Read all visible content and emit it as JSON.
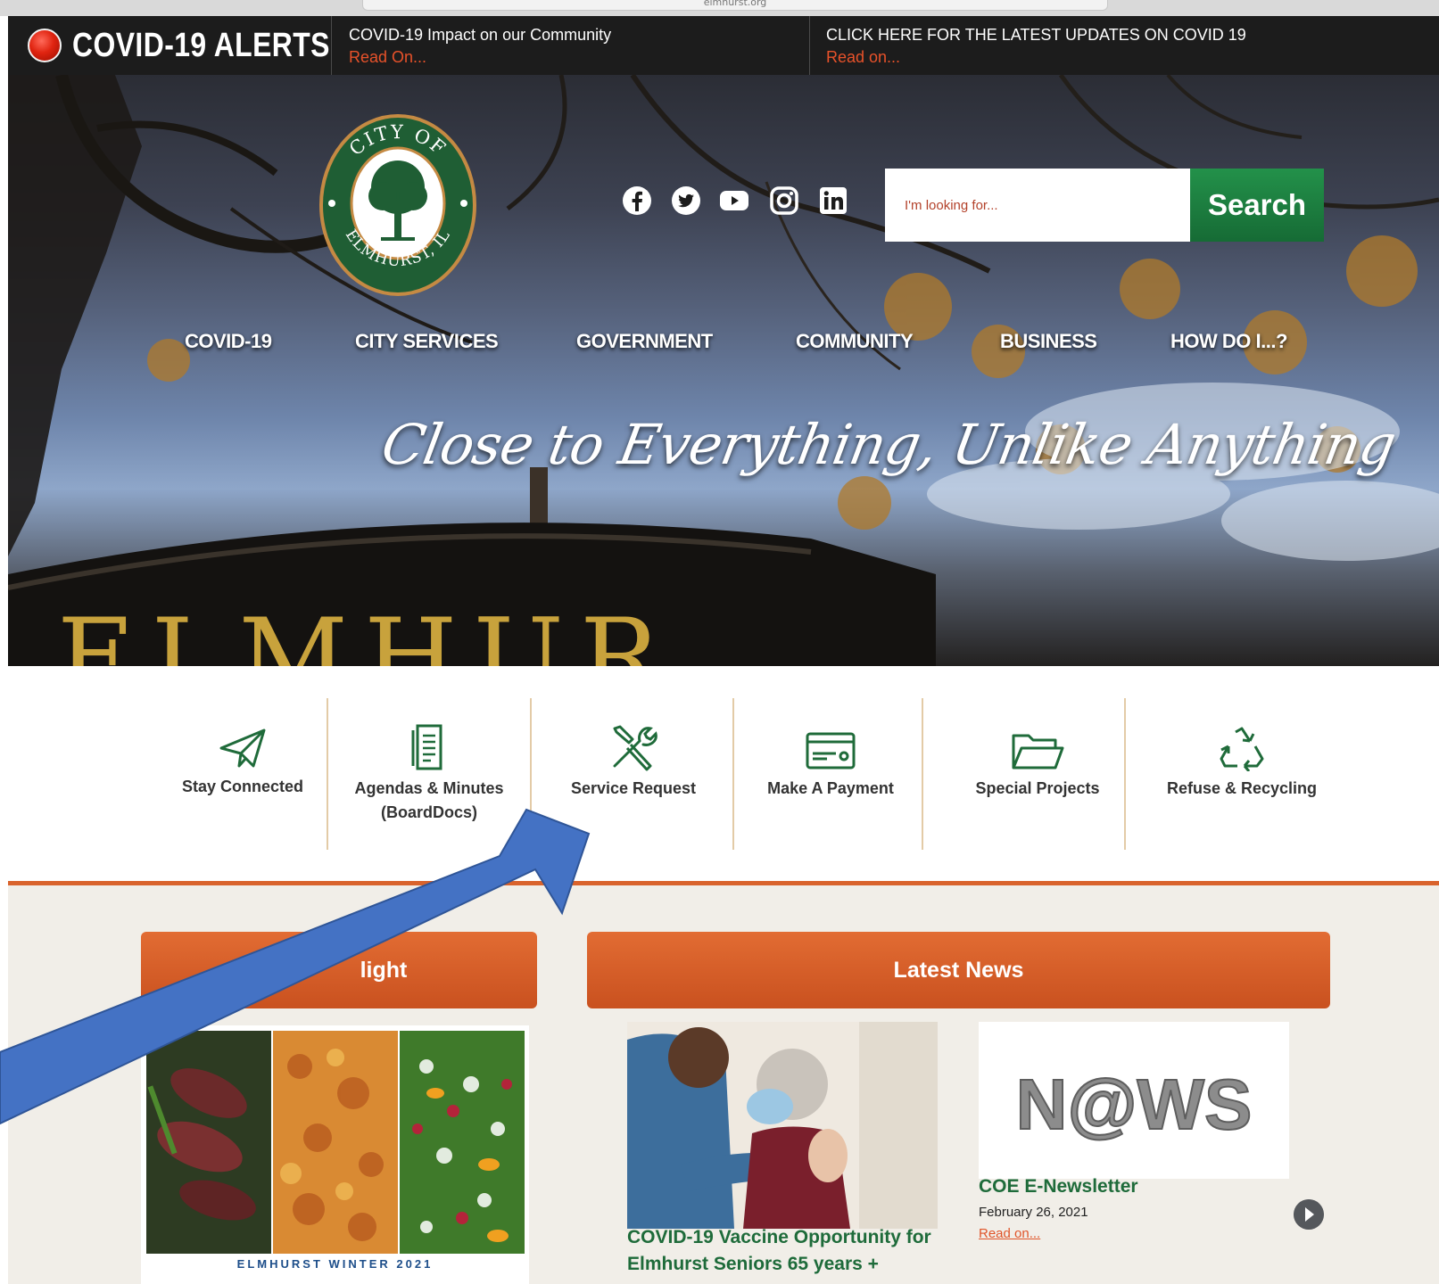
{
  "browser": {
    "url": "elmhurst.org"
  },
  "alerts": {
    "title": "COVID-19 ALERTS",
    "items": [
      {
        "text": "COVID-19 Impact on our Community",
        "link": "Read On..."
      },
      {
        "text": "CLICK HERE FOR THE LATEST UPDATES ON COVID 19",
        "link": "Read on..."
      }
    ]
  },
  "logo": {
    "top": "CITY OF",
    "bottom": "ELMHURST, IL"
  },
  "social": [
    "facebook-icon",
    "twitter-icon",
    "youtube-icon",
    "instagram-icon",
    "linkedin-icon"
  ],
  "search": {
    "placeholder": "I'm looking for...",
    "button": "Search"
  },
  "nav": [
    "COVID-19",
    "CITY SERVICES",
    "GOVERNMENT",
    "COMMUNITY",
    "BUSINESS",
    "HOW DO I...?"
  ],
  "hero": {
    "tagline": "Close to Everything, Unlike Anything",
    "sign_text": "ELMHUR"
  },
  "quick_links": [
    {
      "icon": "paper-plane-icon",
      "label": "Stay Connected"
    },
    {
      "icon": "document-icon",
      "label": "Agendas & Minutes",
      "sub": "(BoardDocs)"
    },
    {
      "icon": "tools-icon",
      "label": "Service Request"
    },
    {
      "icon": "payment-card-icon",
      "label": "Make A Payment"
    },
    {
      "icon": "folder-icon",
      "label": "Special Projects"
    },
    {
      "icon": "recycle-icon",
      "label": "Refuse & Recycling"
    }
  ],
  "spotlight": {
    "header": "light",
    "caption": "ELMHURST WINTER 2021"
  },
  "news": {
    "header": "Latest News",
    "items": [
      {
        "title": "COVID-19 Vaccine Opportunity for Elmhurst Seniors 65 years +"
      },
      {
        "image_text": "N@WS",
        "title": "COE E-Newsletter",
        "date": "February 26, 2021",
        "link": "Read on..."
      }
    ]
  },
  "colors": {
    "alert_bar": "#1c1c1c",
    "accent_orange": "#d9632c",
    "search_green": "#1f8a44",
    "link_red": "#e8522a",
    "news_green": "#1e6b3a",
    "annotation_blue": "#4472c4"
  }
}
